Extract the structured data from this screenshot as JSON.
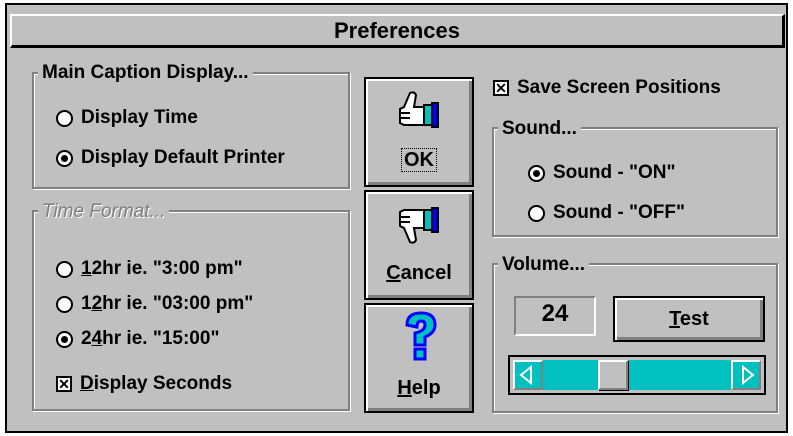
{
  "window": {
    "title": "Preferences"
  },
  "main_caption": {
    "legend": "Main Caption Display...",
    "options": [
      {
        "label": "Display Time",
        "selected": false
      },
      {
        "label": "Display Default Printer",
        "selected": true
      }
    ]
  },
  "time_format": {
    "legend": "Time Format...",
    "options": [
      {
        "mnemonic": "1",
        "rest": "2hr ie. \"3:00 pm\"",
        "selected": false
      },
      {
        "pre": "1",
        "mnemonic": "2",
        "rest": "hr ie. \"03:00 pm\"",
        "selected": false
      },
      {
        "pre": "2",
        "mnemonic": "4",
        "rest": "hr ie. \"15:00\"",
        "selected": true
      }
    ],
    "display_seconds": {
      "mnemonic": "D",
      "rest": "isplay Seconds",
      "checked": true
    }
  },
  "buttons": {
    "ok": {
      "label": "OK",
      "icon": "thumbs-up-icon"
    },
    "cancel": {
      "mnemonic": "C",
      "rest": "ancel",
      "icon": "thumbs-down-icon"
    },
    "help": {
      "mnemonic": "H",
      "rest": "elp",
      "icon": "question-mark-icon"
    }
  },
  "save_screen_positions": {
    "label": "Save Screen Positions",
    "checked": true
  },
  "sound": {
    "legend": "Sound...",
    "options": [
      {
        "label": "Sound - \"ON\"",
        "selected": true
      },
      {
        "label": "Sound - \"OFF\"",
        "selected": false
      }
    ]
  },
  "volume": {
    "legend": "Volume...",
    "value": "24",
    "test": {
      "mnemonic": "T",
      "rest": "est"
    },
    "slider_fraction": 0.35
  },
  "colors": {
    "face": "#c0c0c0",
    "track": "#00c0c0",
    "help_icon": "#0000ff"
  }
}
